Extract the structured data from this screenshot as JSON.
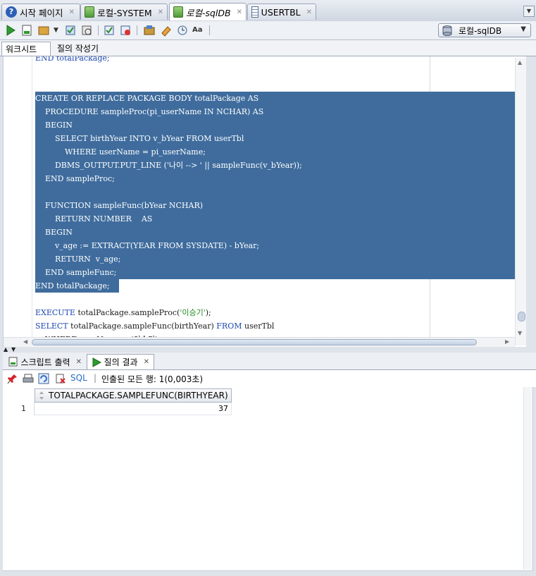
{
  "tabs": [
    {
      "label": "시작 페이지",
      "icon": "help-icon"
    },
    {
      "label": "로컬-SYSTEM",
      "icon": "sql-connection-icon"
    },
    {
      "label": "로컬-sqlDB",
      "icon": "sql-connection-icon",
      "active": true
    },
    {
      "label": "USERTBL",
      "icon": "table-icon"
    }
  ],
  "connection": {
    "label": "로컬-sqlDB",
    "icon": "database-icon"
  },
  "worksheet_tabs": {
    "worksheet": "워크시트",
    "query_builder": "질의 작성기"
  },
  "editor": {
    "lines": [
      {
        "text": "END totalPackage;"
      },
      {
        "text": ""
      },
      {
        "text": ""
      },
      {
        "text": "CREATE OR REPLACE PACKAGE BODY totalPackage AS"
      },
      {
        "text": "    PROCEDURE sampleProc(pi_userName IN NCHAR) AS"
      },
      {
        "text": "    BEGIN"
      },
      {
        "text": "        SELECT birthYear INTO v_bYear FROM userTbl"
      },
      {
        "text": "            WHERE userName = pi_userName;"
      },
      {
        "text": "        DBMS_OUTPUT.PUT_LINE ('나이 --> ' || sampleFunc(v_bYear));"
      },
      {
        "text": "    END sampleProc;"
      },
      {
        "text": ""
      },
      {
        "text": "    FUNCTION sampleFunc(bYear NCHAR)"
      },
      {
        "text": "        RETURN NUMBER    AS"
      },
      {
        "text": "    BEGIN"
      },
      {
        "text": "        v_age := EXTRACT(YEAR FROM SYSDATE) - bYear;"
      },
      {
        "text": "        RETURN  v_age;"
      },
      {
        "text": "    END sampleFunc;"
      },
      {
        "text": "END totalPackage;"
      },
      {
        "text": ""
      },
      {
        "kw1": "EXECUTE",
        "mid": " totalPackage.sampleProc(",
        "str": "'이승기'",
        "end": ");"
      },
      {
        "kw1": "SELECT",
        "mid": " totalPackage.sampleFunc(birthYear) ",
        "kw2": "FROM",
        "end": " userTbl"
      },
      {
        "text": "    WHERE userName = '이승기';"
      }
    ]
  },
  "bottom_tabs": {
    "script_output": "스크립트 출력",
    "query_result": "질의 결과"
  },
  "results": {
    "sql_label": "SQL",
    "fetched_text": "인출된 모든 행: 1(0,003초)",
    "column_header": "TOTALPACKAGE.SAMPLEFUNC(BIRTHYEAR)",
    "rows": [
      {
        "num": "1",
        "value": "37"
      }
    ]
  }
}
